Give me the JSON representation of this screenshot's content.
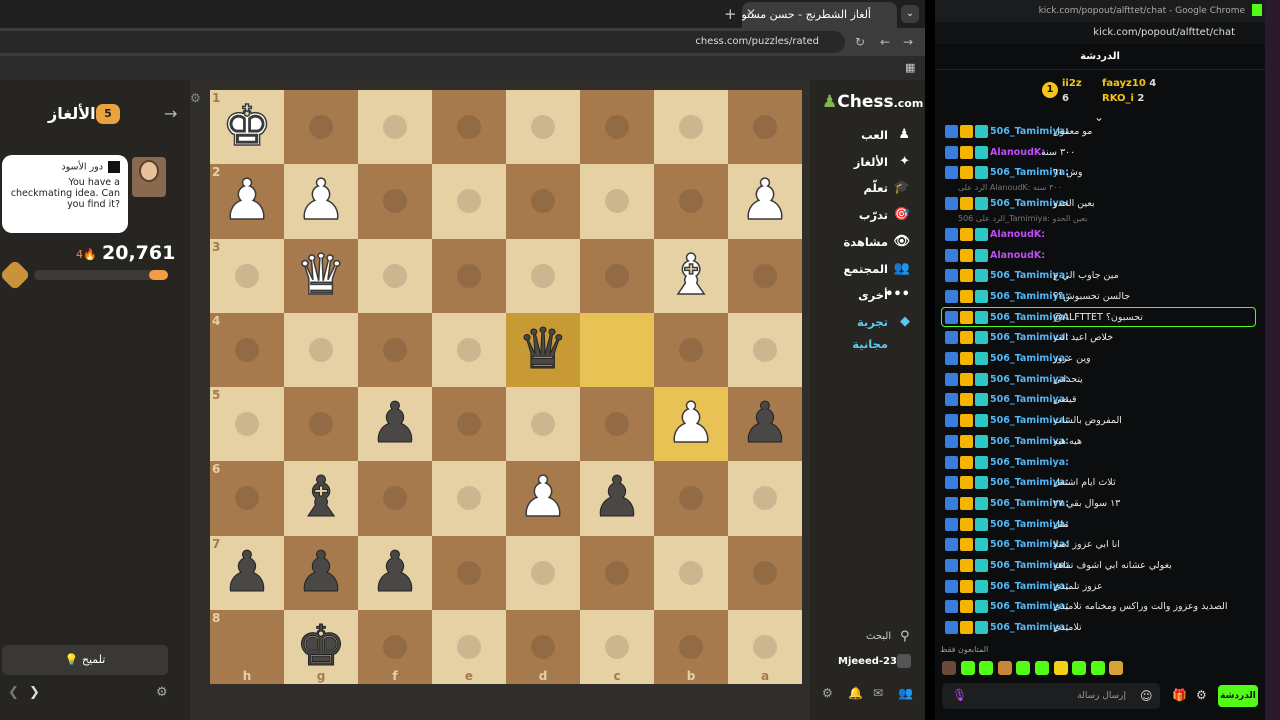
{
  "browser": {
    "tab_title": "ألغاز الشطرنج - حسن مستواك في",
    "url": "chess.com/puzzles/rated"
  },
  "puzzles_panel": {
    "title": "الألغاز",
    "badge": "5",
    "turn_label": "دور الأسود",
    "prompt": "You have a checkmating idea. Can you find it?",
    "rating": "20,761",
    "streak": "4",
    "level": "6",
    "progress_percent": 14,
    "hint_label": "تلميح"
  },
  "board": {
    "ranks": [
      "1",
      "2",
      "3",
      "4",
      "5",
      "6",
      "7",
      "8"
    ],
    "files": [
      "h",
      "g",
      "f",
      "e",
      "d",
      "c",
      "b",
      "a"
    ],
    "highlighted": [
      "d4",
      "c4",
      "b5"
    ],
    "pieces": [
      {
        "sq": "h1",
        "piece": "K",
        "color": "w"
      },
      {
        "sq": "h2",
        "piece": "P",
        "color": "w"
      },
      {
        "sq": "g2",
        "piece": "P",
        "color": "w"
      },
      {
        "sq": "a2",
        "piece": "P",
        "color": "w"
      },
      {
        "sq": "g3",
        "piece": "Q",
        "color": "w"
      },
      {
        "sq": "b3",
        "piece": "B",
        "color": "w"
      },
      {
        "sq": "d4",
        "piece": "Q",
        "color": "b"
      },
      {
        "sq": "f5",
        "piece": "P",
        "color": "b"
      },
      {
        "sq": "b5",
        "piece": "P",
        "color": "w"
      },
      {
        "sq": "a5",
        "piece": "P",
        "color": "b"
      },
      {
        "sq": "g6",
        "piece": "B",
        "color": "b"
      },
      {
        "sq": "d6",
        "piece": "P",
        "color": "w"
      },
      {
        "sq": "c6",
        "piece": "P",
        "color": "b"
      },
      {
        "sq": "h7",
        "piece": "P",
        "color": "b"
      },
      {
        "sq": "g7",
        "piece": "P",
        "color": "b"
      },
      {
        "sq": "f7",
        "piece": "P",
        "color": "b"
      },
      {
        "sq": "g8",
        "piece": "K",
        "color": "b"
      }
    ],
    "move_dots": [
      "g1",
      "e1",
      "d1",
      "c1",
      "b1",
      "f2",
      "e2",
      "d2",
      "c2",
      "b2",
      "e3",
      "d3",
      "c3",
      "h4",
      "g4",
      "f4",
      "e4",
      "h5",
      "e5",
      "d5",
      "c5",
      "f6",
      "e6",
      "b6",
      "a6",
      "e7",
      "d7",
      "c7",
      "b7",
      "a7",
      "f8",
      "e8",
      "d8",
      "c8",
      "b8",
      "a8",
      "g5",
      "f3",
      "a3",
      "a4",
      "h3",
      "h6",
      "b4",
      "a1",
      "f1"
    ]
  },
  "nav": {
    "logo": "Chess",
    "logo_suffix": ".com",
    "items": [
      {
        "label": "العب",
        "icon": "play-icon",
        "glyph": "♟"
      },
      {
        "label": "الألغاز",
        "icon": "puzzle-icon",
        "glyph": "✦"
      },
      {
        "label": "تعلّم",
        "icon": "learn-icon",
        "glyph": "🎓"
      },
      {
        "label": "تدرّب",
        "icon": "train-icon",
        "glyph": "🎯"
      },
      {
        "label": "مشاهدة",
        "icon": "watch-icon",
        "glyph": "👁"
      },
      {
        "label": "المجتمع",
        "icon": "community-icon",
        "glyph": "👥"
      },
      {
        "label": "أخرى",
        "icon": "more-icon",
        "glyph": "•••"
      },
      {
        "label": "تجربة مجانية",
        "icon": "diamond-icon",
        "glyph": "◆"
      }
    ],
    "search_label": "البحث",
    "username": "Mjeeed-230"
  },
  "chat": {
    "window_title": "kick.com/popout/alfttet/chat - Google Chrome",
    "url": "kick.com/popout/alfttet/chat",
    "header": "الدردشة",
    "leaders": [
      {
        "name": "faayz10",
        "count": "4"
      },
      {
        "name": "RKO_i",
        "count": "2"
      },
      {
        "name": "ii2z",
        "count": "6"
      }
    ],
    "leader_rank": "1",
    "messages": [
      {
        "user": "506_Tamimiya",
        "text": "مو معقول",
        "color": "#53b7f5"
      },
      {
        "user": "AlanoudK",
        "text": "٣٠٠ سنه",
        "color": "#c04cf5"
      },
      {
        "user": "506_Tamimiya",
        "text": "وش ٦١",
        "color": "#53b7f5"
      },
      {
        "user": "506_Tamimiya",
        "text": "بعين الحدو",
        "color": "#53b7f5",
        "reply": "الرد على AlanoudK: ٣٠٠ سنه"
      },
      {
        "user": "AlanoudK",
        "text": "",
        "color": "#c04cf5",
        "reply": "الرد على 506_Tamimiya: بعين الحدو"
      },
      {
        "user": "AlanoudK",
        "text": "",
        "color": "#c04cf5"
      },
      {
        "user": "506_Tamimiya",
        "text": "مين جاوب الي ع",
        "color": "#53b7f5"
      },
      {
        "user": "506_Tamimiya",
        "text": "جالسن تحسبوش؟؟",
        "color": "#53b7f5"
      },
      {
        "user": "506_Tamimiya",
        "text": "@ALFTTET تحسبون؟",
        "color": "#53b7f5"
      },
      {
        "user": "506_Tamimiya",
        "text": "خلاص اعيد الث",
        "color": "#53b7f5"
      },
      {
        "user": "506_Tamimiya",
        "text": "وين عزوز",
        "color": "#53b7f5"
      },
      {
        "user": "506_Tamimiya",
        "text": "يتحداني",
        "color": "#53b7f5"
      },
      {
        "user": "506_Tamimiya",
        "text": "قيضي",
        "color": "#53b7f5"
      },
      {
        "user": "506_Tamimiya",
        "text": "المفروض بالشات",
        "color": "#53b7f5"
      },
      {
        "user": "506_Tamimiya",
        "text": "هيه هيه",
        "color": "#53b7f5"
      },
      {
        "user": "506_Tamimiya",
        "text": "",
        "color": "#53b7f5"
      },
      {
        "user": "506_Tamimiya",
        "text": "ثلاث ايام اشتغل",
        "color": "#53b7f5"
      },
      {
        "user": "506_Tamimiya",
        "text": "١٣ سوال بقي ٢٧",
        "color": "#53b7f5"
      },
      {
        "user": "506_Tamimiya",
        "text": "ملل",
        "color": "#53b7f5"
      },
      {
        "user": "506_Tamimiya",
        "text": "انا ابي عزوز اصلا",
        "color": "#53b7f5"
      },
      {
        "user": "506_Tamimiya",
        "text": "بغولي عشانه ابي اشوف تفاهه",
        "color": "#53b7f5"
      },
      {
        "user": "506_Tamimiya",
        "text": "عزوز تلميذي",
        "color": "#53b7f5"
      },
      {
        "user": "506_Tamimiya",
        "text": "الصديد وعزوز والت وراكس ومخنامه تلاميذي",
        "color": "#53b7f5"
      },
      {
        "user": "506_Tamimiya",
        "text": "تلاميذي",
        "color": "#53b7f5"
      }
    ],
    "emotes_label": "المتابعون فقط",
    "input_placeholder": "إرسال رسالة",
    "send_label": "الدردشة"
  }
}
